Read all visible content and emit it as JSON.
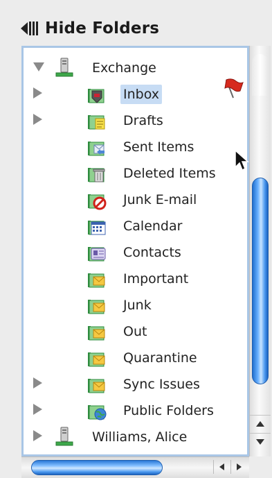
{
  "header": {
    "title": "Hide Folders"
  },
  "tree": {
    "items": [
      {
        "label": "Exchange",
        "level": 0,
        "disclosure": "down",
        "icon": "computer-icon"
      },
      {
        "label": "Inbox",
        "level": 1,
        "disclosure": "right",
        "icon": "inbox-icon",
        "selected": true,
        "flagged": true
      },
      {
        "label": "Drafts",
        "level": 1,
        "disclosure": "right",
        "icon": "drafts-icon"
      },
      {
        "label": "Sent Items",
        "level": 1,
        "disclosure": "none",
        "icon": "sent-items-icon"
      },
      {
        "label": "Deleted Items",
        "level": 1,
        "disclosure": "none",
        "icon": "deleted-items-icon"
      },
      {
        "label": "Junk E-mail",
        "level": 1,
        "disclosure": "none",
        "icon": "junk-email-icon"
      },
      {
        "label": "Calendar",
        "level": 1,
        "disclosure": "none",
        "icon": "calendar-icon"
      },
      {
        "label": "Contacts",
        "level": 1,
        "disclosure": "none",
        "icon": "contacts-icon"
      },
      {
        "label": "Important",
        "level": 1,
        "disclosure": "none",
        "icon": "mail-folder-icon"
      },
      {
        "label": "Junk",
        "level": 1,
        "disclosure": "none",
        "icon": "mail-folder-icon"
      },
      {
        "label": "Out",
        "level": 1,
        "disclosure": "none",
        "icon": "mail-folder-icon"
      },
      {
        "label": "Quarantine",
        "level": 1,
        "disclosure": "none",
        "icon": "mail-folder-icon"
      },
      {
        "label": "Sync Issues",
        "level": 1,
        "disclosure": "right",
        "icon": "mail-folder-icon"
      },
      {
        "label": "Public Folders",
        "level": 1,
        "disclosure": "right",
        "icon": "public-folders-icon"
      },
      {
        "label": "Williams, Alice",
        "level": 0,
        "disclosure": "right",
        "icon": "computer-icon"
      }
    ]
  },
  "colors": {
    "selection": "#c7dcf4",
    "frame_border": "#a9c6e6",
    "scroll_thumb": "#4b98ef",
    "flag": "#d62a1e",
    "folder_green": "#2e8b3e"
  }
}
